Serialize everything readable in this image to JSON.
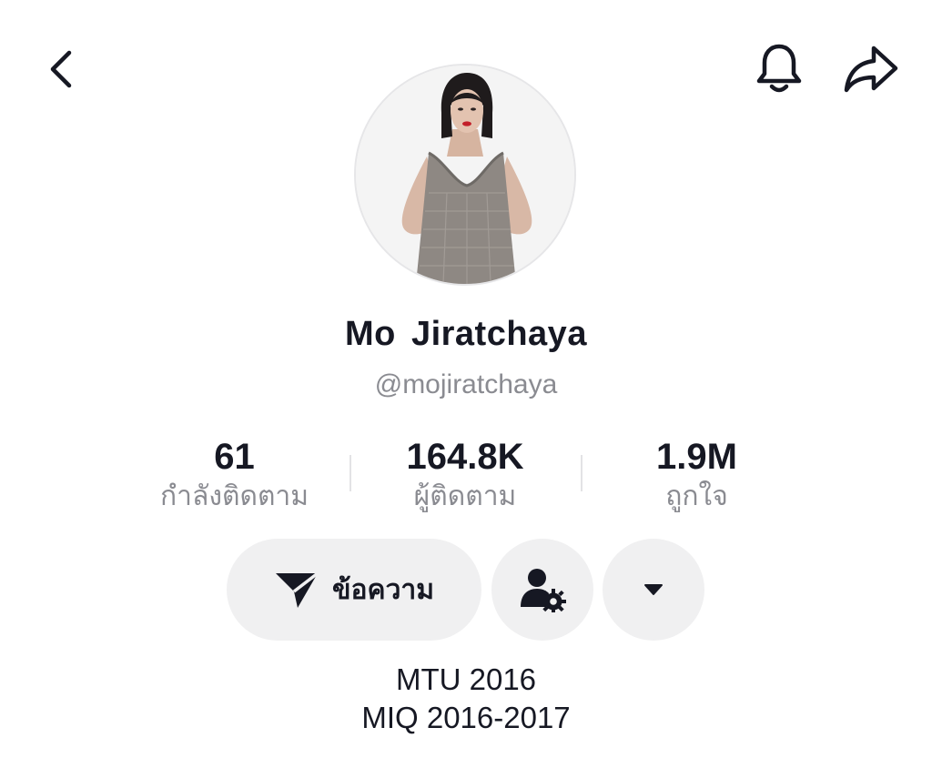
{
  "header": {
    "back_icon": "chevron-left-icon",
    "bell_icon": "bell-icon",
    "share_icon": "share-arrow-icon"
  },
  "profile": {
    "display_name": "Mo  Jiratchaya",
    "handle": "@mojiratchaya"
  },
  "stats": {
    "following": {
      "value": "61",
      "label": "กำลังติดตาม"
    },
    "followers": {
      "value": "164.8K",
      "label": "ผู้ติดตาม"
    },
    "likes": {
      "value": "1.9M",
      "label": "ถูกใจ"
    }
  },
  "actions": {
    "message_label": "ข้อความ",
    "message_icon": "send-icon",
    "friend_settings_icon": "user-gear-icon",
    "more_icon": "caret-down-icon"
  },
  "bio": {
    "lines": [
      "MTU 2016",
      "MIQ 2016-2017"
    ]
  },
  "colors": {
    "text_primary": "#161823",
    "text_secondary": "#8a8b91",
    "button_bg": "#f0f0f1"
  }
}
